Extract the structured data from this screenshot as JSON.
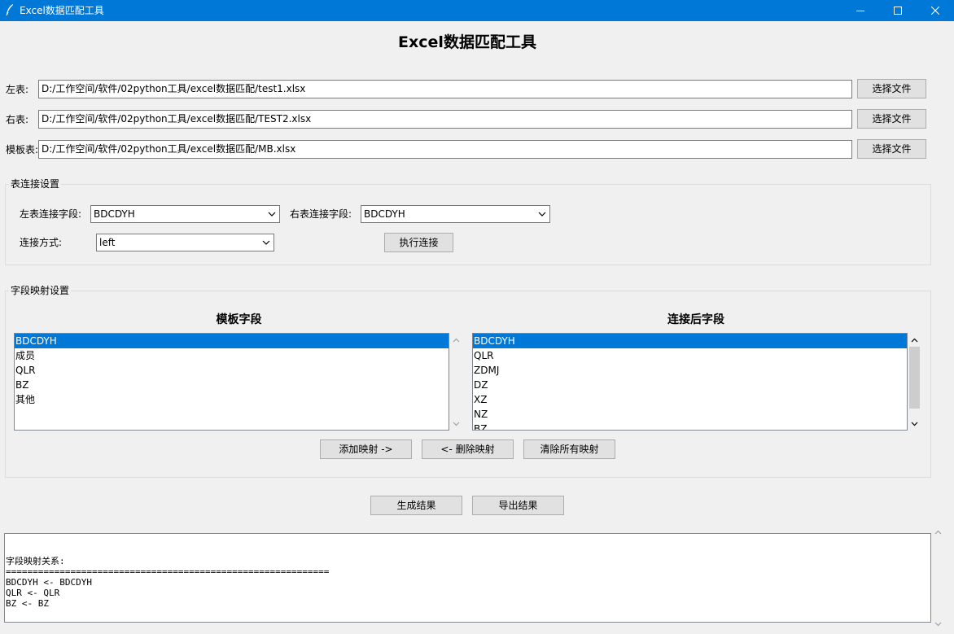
{
  "window": {
    "title": "Excel数据匹配工具",
    "icon": "feather-icon",
    "controls": [
      "minimize-icon",
      "maximize-icon",
      "close-icon"
    ]
  },
  "heading": "Excel数据匹配工具",
  "files": {
    "left": {
      "label": "左表:",
      "path": "D:/工作空间/软件/02python工具/excel数据匹配/test1.xlsx",
      "button": "选择文件"
    },
    "right": {
      "label": "右表:",
      "path": "D:/工作空间/软件/02python工具/excel数据匹配/TEST2.xlsx",
      "button": "选择文件"
    },
    "template": {
      "label": "模板表:",
      "path": "D:/工作空间/软件/02python工具/excel数据匹配/MB.xlsx",
      "button": "选择文件"
    }
  },
  "join": {
    "group_title": "表连接设置",
    "left_field_label": "左表连接字段:",
    "left_field_value": "BDCDYH",
    "right_field_label": "右表连接字段:",
    "right_field_value": "BDCDYH",
    "method_label": "连接方式:",
    "method_value": "left",
    "execute_button": "执行连接"
  },
  "mapping": {
    "group_title": "字段映射设置",
    "template_title": "模板字段",
    "template_fields": [
      "BDCDYH",
      "成员",
      "QLR",
      "BZ",
      "其他"
    ],
    "template_selected": 0,
    "joined_title": "连接后字段",
    "joined_fields": [
      "BDCDYH",
      "QLR",
      "ZDMJ",
      "DZ",
      "XZ",
      "NZ",
      "BZ"
    ],
    "joined_selected": 0,
    "add_button": "添加映射 ->",
    "remove_button": "<- 删除映射",
    "clear_button": "清除所有映射"
  },
  "actions": {
    "generate_button": "生成结果",
    "export_button": "导出结果"
  },
  "output": {
    "lines": [
      "字段映射关系:",
      "============================================================",
      "BDCDYH <- BDCDYH",
      "QLR <- QLR",
      "BZ <- BZ"
    ]
  }
}
